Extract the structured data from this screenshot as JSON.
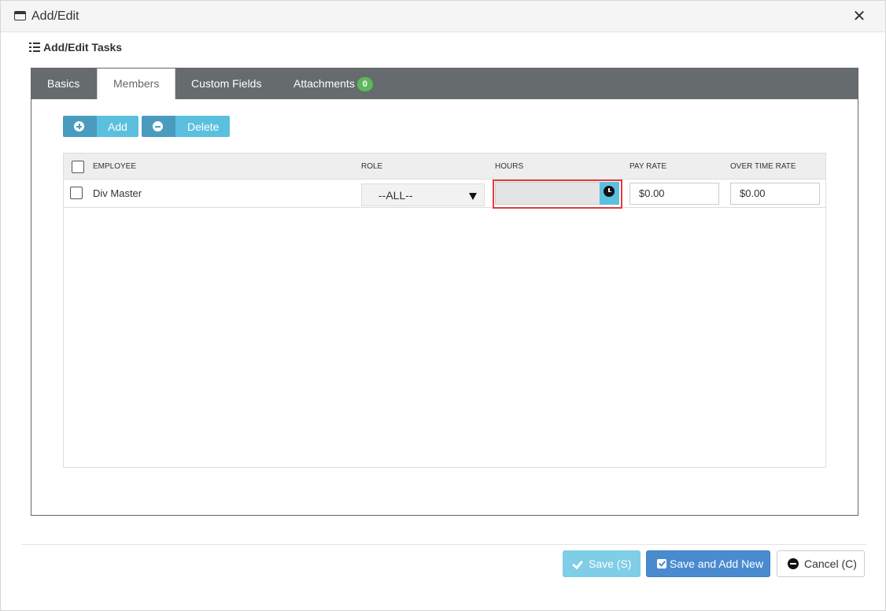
{
  "window": {
    "title": "Add/Edit"
  },
  "section": {
    "title": "Add/Edit Tasks"
  },
  "tabs": [
    {
      "label": "Basics"
    },
    {
      "label": "Members"
    },
    {
      "label": "Custom Fields"
    },
    {
      "label": "Attachments",
      "badge": "0"
    }
  ],
  "toolbar": {
    "add_label": "Add",
    "delete_label": "Delete"
  },
  "grid": {
    "columns": [
      "EMPLOYEE",
      "ROLE",
      "HOURS",
      "PAY RATE",
      "OVER TIME RATE"
    ],
    "rows": [
      {
        "employee": "Div Master",
        "role": "--ALL--",
        "hours": "",
        "pay_rate": "$0.00",
        "overtime_rate": "$0.00"
      }
    ]
  },
  "footer": {
    "save_label": "Save (S)",
    "save_new_label": "Save and Add New",
    "cancel_label": "Cancel (C)"
  }
}
